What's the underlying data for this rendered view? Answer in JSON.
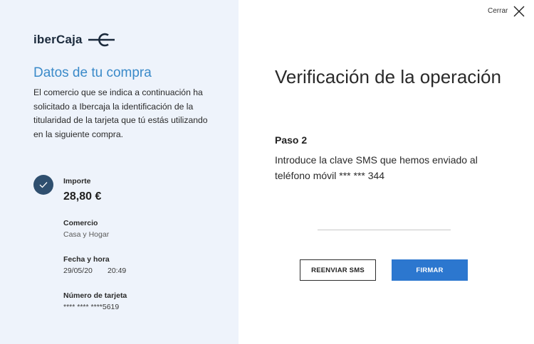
{
  "brand": {
    "logo_text": "iberCaja",
    "logo_mark_icon": "ibercaja-arrow-mark",
    "accent_color": "#3a8ac9"
  },
  "header": {
    "close_label": "Cerrar",
    "close_icon": "close-icon"
  },
  "purchase": {
    "title": "Datos de tu compra",
    "description": "El comercio que se indica a continuación ha solicitado a Ibercaja la identificación de la titularidad de la tarjeta que tú estás utilizando en la siguiente compra.",
    "status_icon": "check-icon",
    "amount_label": "Importe",
    "amount_value": "28,80 €",
    "merchant_label": "Comercio",
    "merchant_value": "Casa y Hogar",
    "datetime_label": "Fecha y hora",
    "date_value": "29/05/20",
    "time_value": "20:49",
    "card_label": "Número de tarjeta",
    "card_value": "**** **** ****5619"
  },
  "verification": {
    "title": "Verificación de la operación",
    "step_label": "Paso 2",
    "step_description": "Introduce la clave SMS que hemos enviado al teléfono móvil *** *** 344",
    "sms_input_value": "",
    "resend_button": "REENVIAR SMS",
    "sign_button": "FIRMAR",
    "button_color": "#2c77cf"
  }
}
